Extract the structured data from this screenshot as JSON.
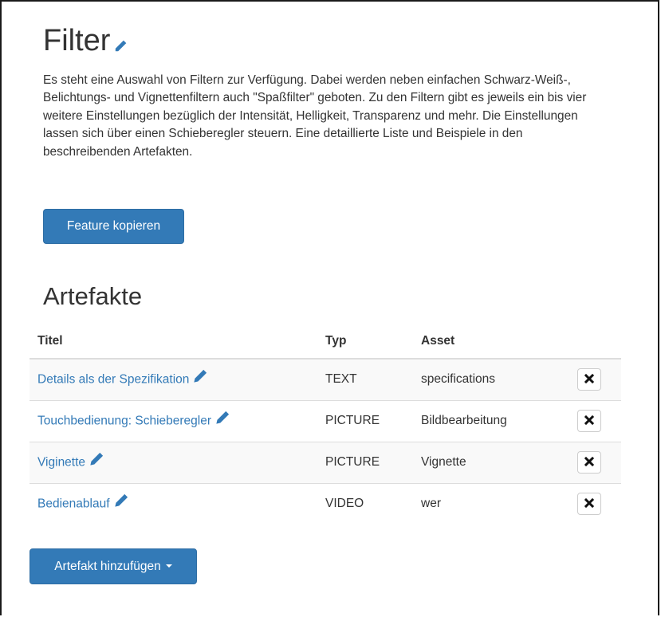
{
  "feature": {
    "title": "Filter",
    "description": "Es steht eine Auswahl von Filtern zur Verfügung. Dabei werden neben einfachen Schwarz-Weiß-, Belichtungs- und Vignettenfiltern auch \"Spaßfilter\" geboten. Zu den Filtern gibt es jeweils ein bis vier weitere Einstellungen bezüglich der Intensität, Helligkeit, Transparenz und mehr. Die Einstellungen lassen sich über einen Schieberegler steuern. Eine detaillierte Liste und Beispiele in den beschreibenden Artefakten.",
    "copy_button": "Feature kopieren",
    "edit_icon": "pencil-icon"
  },
  "artifacts": {
    "heading": "Artefakte",
    "columns": {
      "title": "Titel",
      "type": "Typ",
      "asset": "Asset"
    },
    "rows": [
      {
        "title": "Details als der Spezifikation",
        "type": "TEXT",
        "asset": "specifications"
      },
      {
        "title": "Touchbedienung: Schieberegler",
        "type": "PICTURE",
        "asset": "Bildbearbeitung"
      },
      {
        "title": "Viginette",
        "type": "PICTURE",
        "asset": "Vignette"
      },
      {
        "title": "Bedienablauf",
        "type": "VIDEO",
        "asset": "wer"
      }
    ],
    "delete_icon": "close-icon",
    "add_button": "Artefakt hinzufügen"
  },
  "colors": {
    "primary": "#337ab7",
    "text": "#333333",
    "stripe": "#f9f9f9",
    "border": "#dddddd"
  }
}
